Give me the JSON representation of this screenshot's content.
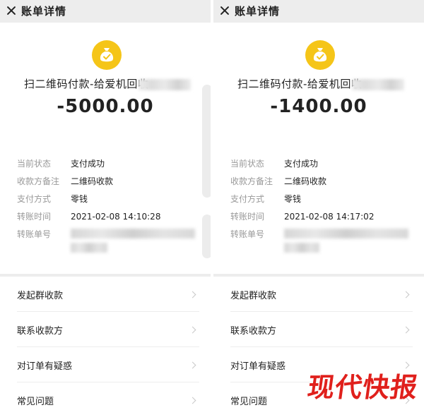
{
  "screens": [
    {
      "header": {
        "title": "账单详情"
      },
      "bill": {
        "payee": "扫二维码付款-给爱机回收",
        "amount": "-5000.00",
        "details": [
          {
            "label": "当前状态",
            "value": "支付成功"
          },
          {
            "label": "收款方备注",
            "value": "二维码收款"
          },
          {
            "label": "支付方式",
            "value": "零钱"
          },
          {
            "label": "转账时间",
            "value": "2021-02-08 14:10:28"
          },
          {
            "label": "转账单号",
            "value": ""
          }
        ]
      },
      "menu": [
        {
          "label": "发起群收款"
        },
        {
          "label": "联系收款方"
        },
        {
          "label": "对订单有疑惑"
        },
        {
          "label": "常见问题"
        }
      ]
    },
    {
      "header": {
        "title": "账单详情"
      },
      "bill": {
        "payee": "扫二维码付款-给爱机回收",
        "amount": "-1400.00",
        "details": [
          {
            "label": "当前状态",
            "value": "支付成功"
          },
          {
            "label": "收款方备注",
            "value": "二维码收款"
          },
          {
            "label": "支付方式",
            "value": "零钱"
          },
          {
            "label": "转账时间",
            "value": "2021-02-08 14:17:02"
          },
          {
            "label": "转账单号",
            "value": ""
          }
        ]
      },
      "menu": [
        {
          "label": "发起群收款"
        },
        {
          "label": "联系收款方"
        },
        {
          "label": "对订单有疑惑"
        },
        {
          "label": "常见问题"
        }
      ]
    }
  ],
  "watermark": "现代快报",
  "colors": {
    "coin": "#f5c518",
    "watermark": "#e0201c"
  },
  "icons": {
    "close": "close-icon",
    "coin": "money-bag-icon",
    "chevron": "chevron-right-icon"
  }
}
